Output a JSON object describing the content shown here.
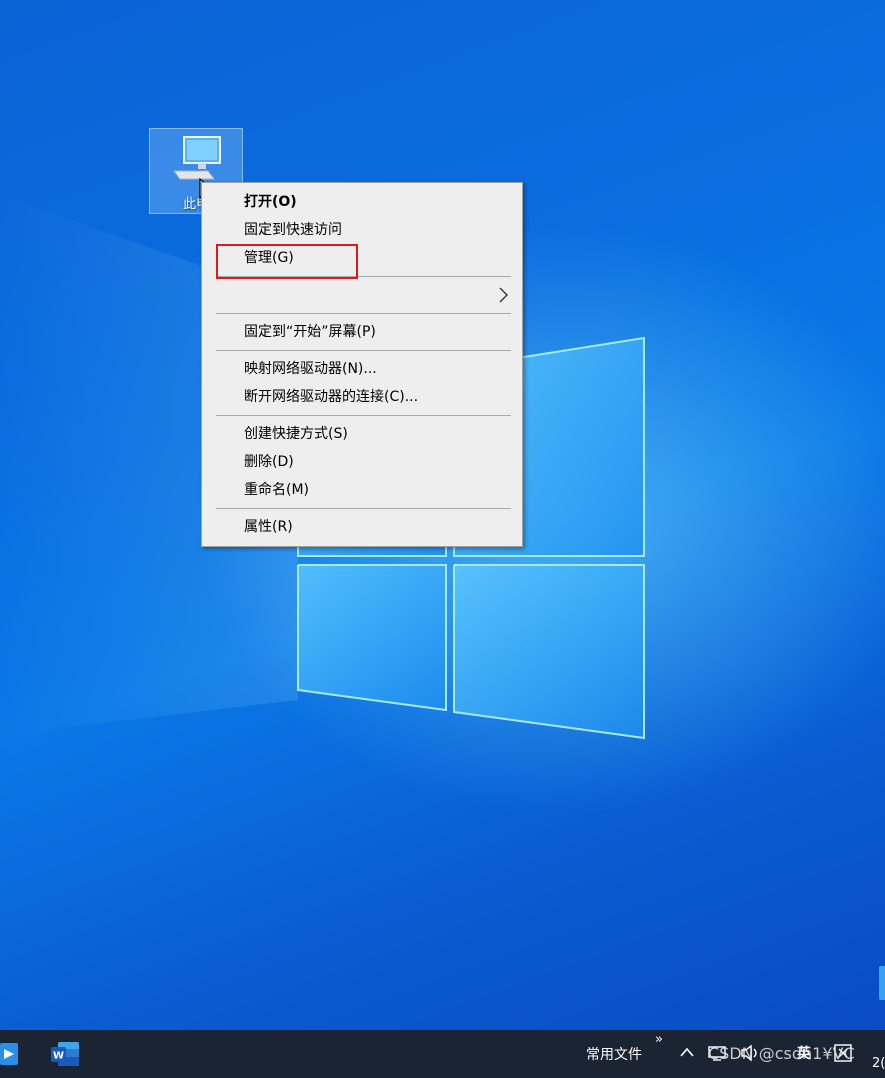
{
  "desktop": {
    "icon_label": "此电",
    "icon_name": "this-pc-icon"
  },
  "context_menu": {
    "items": [
      {
        "label": "打开(O)",
        "bold": true
      },
      {
        "label": "固定到快速访问"
      },
      {
        "label": "管理(G)",
        "highlighted": true
      },
      {
        "label": "",
        "has_submenu": true
      },
      {
        "label": "固定到“开始”屏幕(P)"
      },
      {
        "label": "映射网络驱动器(N)..."
      },
      {
        "label": "断开网络驱动器的连接(C)..."
      },
      {
        "label": "创建快捷方式(S)"
      },
      {
        "label": "删除(D)"
      },
      {
        "label": "重命名(M)"
      },
      {
        "label": "属性(R)"
      }
    ]
  },
  "annotation": {
    "highlight_color": "#e0191c"
  },
  "taskbar": {
    "folder_label": "常用文件",
    "overflow": "»",
    "ime_label": "英",
    "clock": "2("
  },
  "watermark": "CSDN @csdn1¥VC",
  "colors": {
    "desktop_blue": "#0a6fe0",
    "menu_bg": "#eeeeee",
    "taskbar_bg": "#1b2433"
  }
}
